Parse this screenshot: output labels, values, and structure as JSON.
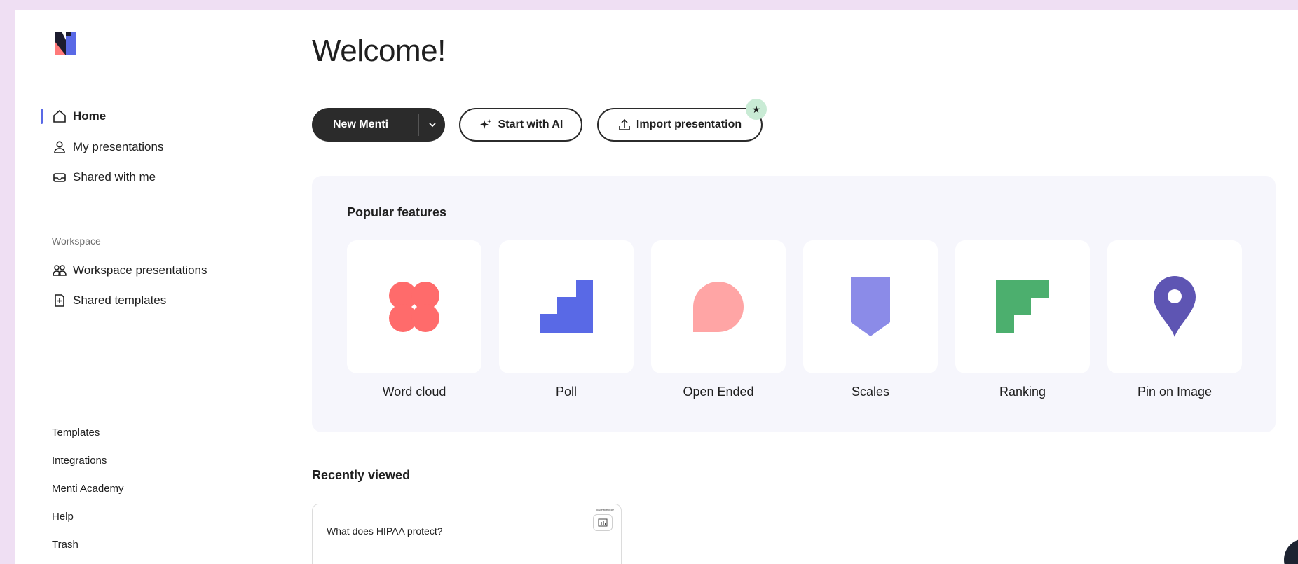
{
  "sidebar": {
    "nav": [
      {
        "label": "Home",
        "icon": "home-icon"
      },
      {
        "label": "My presentations",
        "icon": "user-icon"
      },
      {
        "label": "Shared with me",
        "icon": "inbox-icon"
      }
    ],
    "workspace_label": "Workspace",
    "workspace_items": [
      {
        "label": "Workspace presentations",
        "icon": "users-icon"
      },
      {
        "label": "Shared templates",
        "icon": "template-add-icon"
      }
    ],
    "footer_links": [
      "Templates",
      "Integrations",
      "Menti Academy",
      "Help",
      "Trash"
    ]
  },
  "main": {
    "title": "Welcome!",
    "new_menti_label": "New Menti",
    "start_ai_label": "Start with AI",
    "import_label": "Import presentation",
    "popular_title": "Popular features",
    "features": [
      {
        "label": "Word cloud",
        "icon": "word-cloud-icon",
        "color": "#ff6b6b"
      },
      {
        "label": "Poll",
        "icon": "poll-icon",
        "color": "#5969e6"
      },
      {
        "label": "Open Ended",
        "icon": "open-ended-icon",
        "color": "#ffa5a5"
      },
      {
        "label": "Scales",
        "icon": "scales-icon",
        "color": "#8b8be8"
      },
      {
        "label": "Ranking",
        "icon": "ranking-icon",
        "color": "#4caf6e"
      },
      {
        "label": "Pin on Image",
        "icon": "pin-icon",
        "color": "#5e55b3"
      }
    ],
    "recent_title": "Recently viewed",
    "recent_items": [
      {
        "question": "What does HIPAA protect?",
        "brand": "Mentimeter"
      }
    ]
  },
  "colors": {
    "accent": "#5969e6",
    "page_background": "#efdff3",
    "primary_button": "#2b2b2b",
    "badge": "#c9ebd5"
  }
}
